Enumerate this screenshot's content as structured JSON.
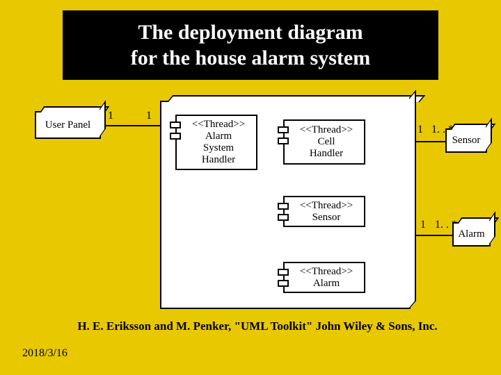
{
  "title": {
    "line1": "The deployment diagram",
    "line2": "for the house alarm system"
  },
  "nodes": {
    "user_panel": "User Panel",
    "sensor": "Sensor",
    "alarm": "Alarm"
  },
  "components": {
    "alarm_system": {
      "stereotype": "<<Thread>>",
      "l1": "Alarm",
      "l2": "System",
      "l3": "Handler"
    },
    "cell": {
      "stereotype": "<<Thread>>",
      "l1": "Cell",
      "l2": "Handler"
    },
    "sensor": {
      "stereotype": "<<Thread>>",
      "l1": "Sensor"
    },
    "alarm": {
      "stereotype": "<<Thread>>",
      "l1": "Alarm"
    }
  },
  "multiplicities": {
    "user_panel_right": "1",
    "main_left": "1",
    "main_right_top": "1",
    "sensor_left": "1. . *",
    "main_right_bottom": "1",
    "alarm_left": "1. . *"
  },
  "citation": "H. E. Eriksson and M. Penker, \"UML Toolkit\" John Wiley & Sons, Inc.",
  "date": "2018/3/16"
}
